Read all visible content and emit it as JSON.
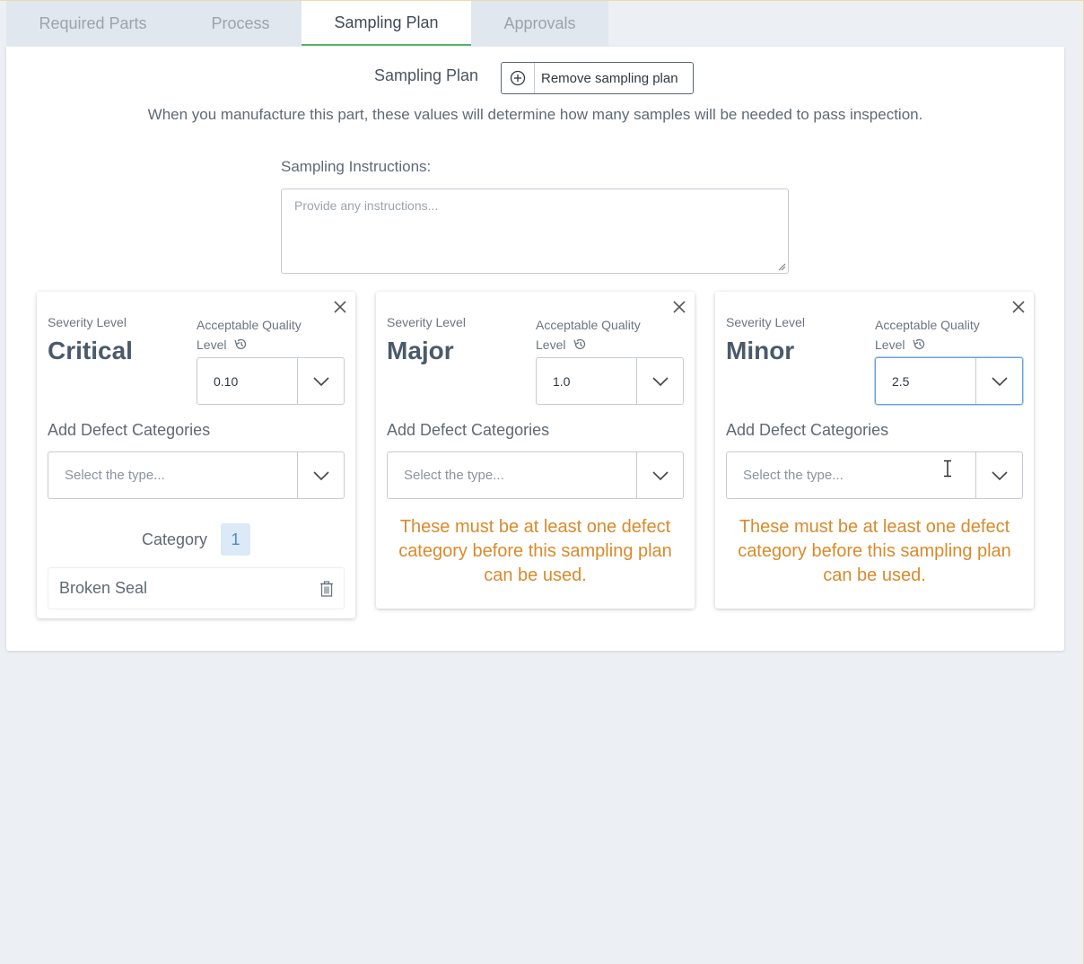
{
  "tabs": [
    {
      "label": "Required Parts",
      "active": false
    },
    {
      "label": "Process",
      "active": false
    },
    {
      "label": "Sampling Plan",
      "active": true
    },
    {
      "label": "Approvals",
      "active": false
    }
  ],
  "header": {
    "title": "Sampling Plan",
    "remove_button_label": "Remove sampling plan",
    "remove_button_icon": "plus-circle-icon",
    "description": "When you manufacture this part, these values will determine how many samples will be needed to pass inspection."
  },
  "instructions": {
    "label": "Sampling Instructions:",
    "placeholder": "Provide any instructions..."
  },
  "cards": [
    {
      "severity_label": "Severity Level",
      "severity": "Critical",
      "aql_label": "Acceptable Quality Level",
      "aql_value": "0.10",
      "defect_label": "Add Defect Categories",
      "defect_placeholder": "Select the type...",
      "category_label": "Category",
      "category_count": "1",
      "categories": [
        "Broken Seal"
      ]
    },
    {
      "severity_label": "Severity Level",
      "severity": "Major",
      "aql_label": "Acceptable Quality Level",
      "aql_value": "1.0",
      "defect_label": "Add Defect Categories",
      "defect_placeholder": "Select the type...",
      "warning": "These must be at least one defect category before this sampling plan can be used."
    },
    {
      "severity_label": "Severity Level",
      "severity": "Minor",
      "aql_label": "Acceptable Quality Level",
      "aql_value": "2.5",
      "defect_label": "Add Defect Categories",
      "defect_placeholder": "Select the type...",
      "warning": "These must be at least one defect category before this sampling plan can be used."
    }
  ],
  "colors": {
    "active_tab_underline": "#58b368",
    "warning_text": "#d98a2b",
    "badge_bg": "#dce9f6",
    "focus_border": "#6a9fd6"
  }
}
